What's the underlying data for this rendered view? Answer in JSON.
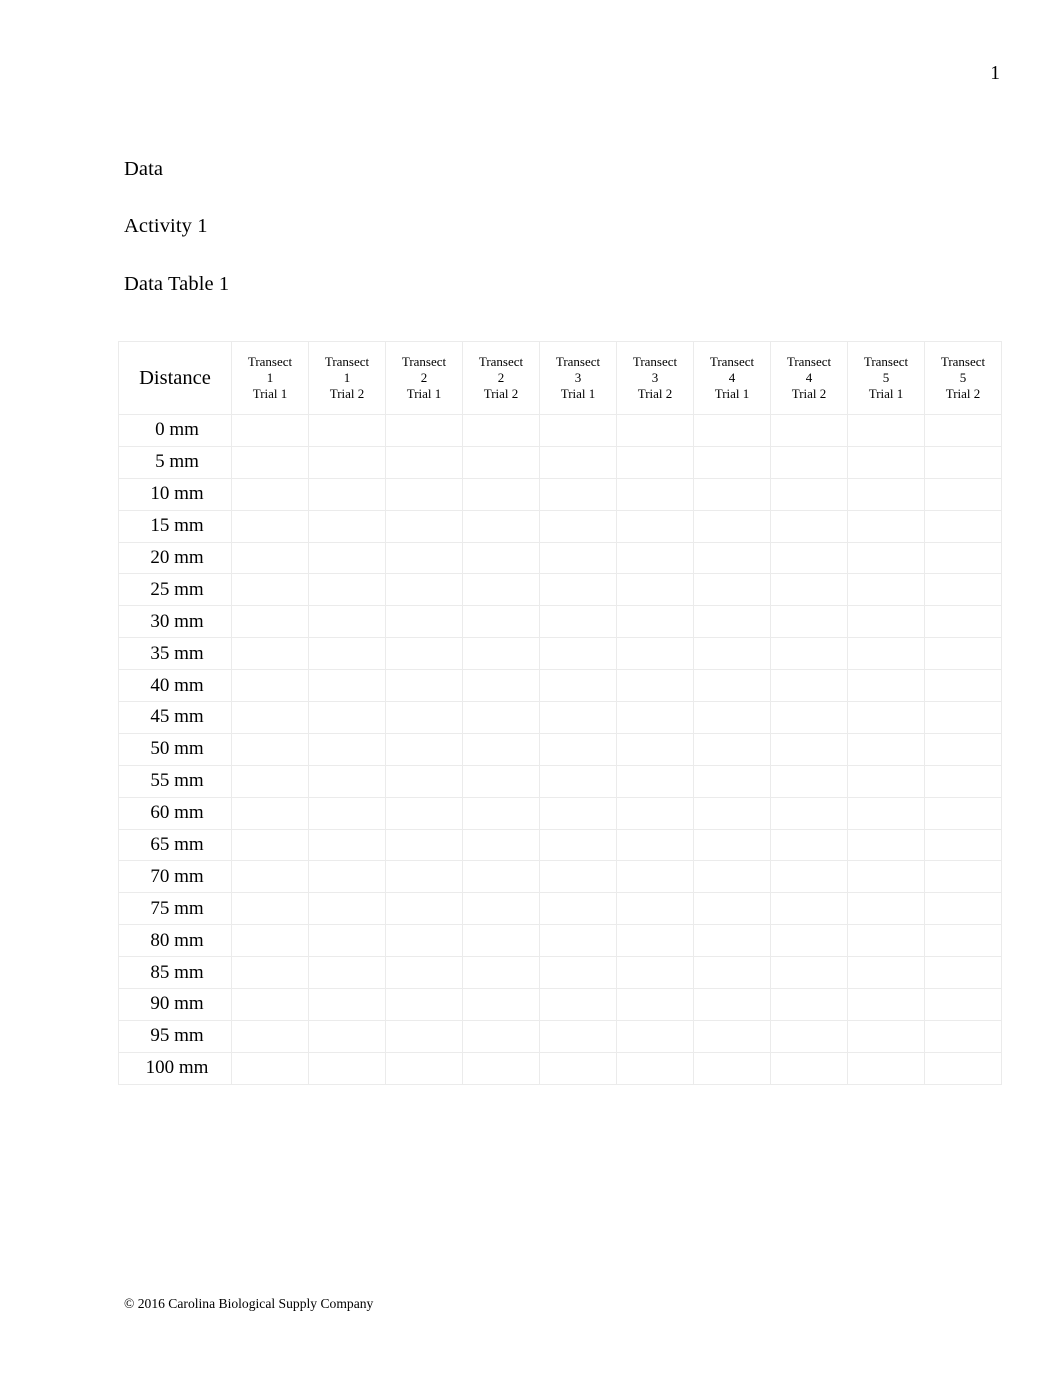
{
  "document": {
    "page_number": "1",
    "footer": "© 2016 Carolina Biological Supply Company"
  },
  "headings": {
    "section": "Data",
    "activity": "Activity 1",
    "table_title": "Data Table 1"
  },
  "table": {
    "distance_header": "Distance",
    "columns": [
      {
        "name": "Transect",
        "number": "1",
        "trial": "Trial 1"
      },
      {
        "name": "Transect",
        "number": "1",
        "trial": "Trial 2"
      },
      {
        "name": "Transect",
        "number": "2",
        "trial": "Trial 1"
      },
      {
        "name": "Transect",
        "number": "2",
        "trial": "Trial 2"
      },
      {
        "name": "Transect",
        "number": "3",
        "trial": "Trial 1"
      },
      {
        "name": "Transect",
        "number": "3",
        "trial": "Trial 2"
      },
      {
        "name": "Transect",
        "number": "4",
        "trial": "Trial 1"
      },
      {
        "name": "Transect",
        "number": "4",
        "trial": "Trial 2"
      },
      {
        "name": "Transect",
        "number": "5",
        "trial": "Trial 1"
      },
      {
        "name": "Transect",
        "number": "5",
        "trial": "Trial 2"
      }
    ],
    "rows": [
      {
        "distance": "0 mm",
        "values": [
          "",
          "",
          "",
          "",
          "",
          "",
          "",
          "",
          "",
          ""
        ]
      },
      {
        "distance": "5 mm",
        "values": [
          "",
          "",
          "",
          "",
          "",
          "",
          "",
          "",
          "",
          ""
        ]
      },
      {
        "distance": "10 mm",
        "values": [
          "",
          "",
          "",
          "",
          "",
          "",
          "",
          "",
          "",
          ""
        ]
      },
      {
        "distance": "15 mm",
        "values": [
          "",
          "",
          "",
          "",
          "",
          "",
          "",
          "",
          "",
          ""
        ]
      },
      {
        "distance": "20 mm",
        "values": [
          "",
          "",
          "",
          "",
          "",
          "",
          "",
          "",
          "",
          ""
        ]
      },
      {
        "distance": "25 mm",
        "values": [
          "",
          "",
          "",
          "",
          "",
          "",
          "",
          "",
          "",
          ""
        ]
      },
      {
        "distance": "30 mm",
        "values": [
          "",
          "",
          "",
          "",
          "",
          "",
          "",
          "",
          "",
          ""
        ]
      },
      {
        "distance": "35 mm",
        "values": [
          "",
          "",
          "",
          "",
          "",
          "",
          "",
          "",
          "",
          ""
        ]
      },
      {
        "distance": "40 mm",
        "values": [
          "",
          "",
          "",
          "",
          "",
          "",
          "",
          "",
          "",
          ""
        ]
      },
      {
        "distance": "45 mm",
        "values": [
          "",
          "",
          "",
          "",
          "",
          "",
          "",
          "",
          "",
          ""
        ]
      },
      {
        "distance": "50 mm",
        "values": [
          "",
          "",
          "",
          "",
          "",
          "",
          "",
          "",
          "",
          ""
        ]
      },
      {
        "distance": "55 mm",
        "values": [
          "",
          "",
          "",
          "",
          "",
          "",
          "",
          "",
          "",
          ""
        ]
      },
      {
        "distance": "60 mm",
        "values": [
          "",
          "",
          "",
          "",
          "",
          "",
          "",
          "",
          "",
          ""
        ]
      },
      {
        "distance": "65 mm",
        "values": [
          "",
          "",
          "",
          "",
          "",
          "",
          "",
          "",
          "",
          ""
        ]
      },
      {
        "distance": "70 mm",
        "values": [
          "",
          "",
          "",
          "",
          "",
          "",
          "",
          "",
          "",
          ""
        ]
      },
      {
        "distance": "75 mm",
        "values": [
          "",
          "",
          "",
          "",
          "",
          "",
          "",
          "",
          "",
          ""
        ]
      },
      {
        "distance": "80 mm",
        "values": [
          "",
          "",
          "",
          "",
          "",
          "",
          "",
          "",
          "",
          ""
        ]
      },
      {
        "distance": "85 mm",
        "values": [
          "",
          "",
          "",
          "",
          "",
          "",
          "",
          "",
          "",
          ""
        ]
      },
      {
        "distance": "90 mm",
        "values": [
          "",
          "",
          "",
          "",
          "",
          "",
          "",
          "",
          "",
          ""
        ]
      },
      {
        "distance": "95 mm",
        "values": [
          "",
          "",
          "",
          "",
          "",
          "",
          "",
          "",
          "",
          ""
        ]
      },
      {
        "distance": "100 mm",
        "values": [
          "",
          "",
          "",
          "",
          "",
          "",
          "",
          "",
          "",
          ""
        ]
      }
    ]
  },
  "colors": {
    "page_background": "#ffffff",
    "text": "#000000",
    "gridline": "#ebebeb"
  }
}
